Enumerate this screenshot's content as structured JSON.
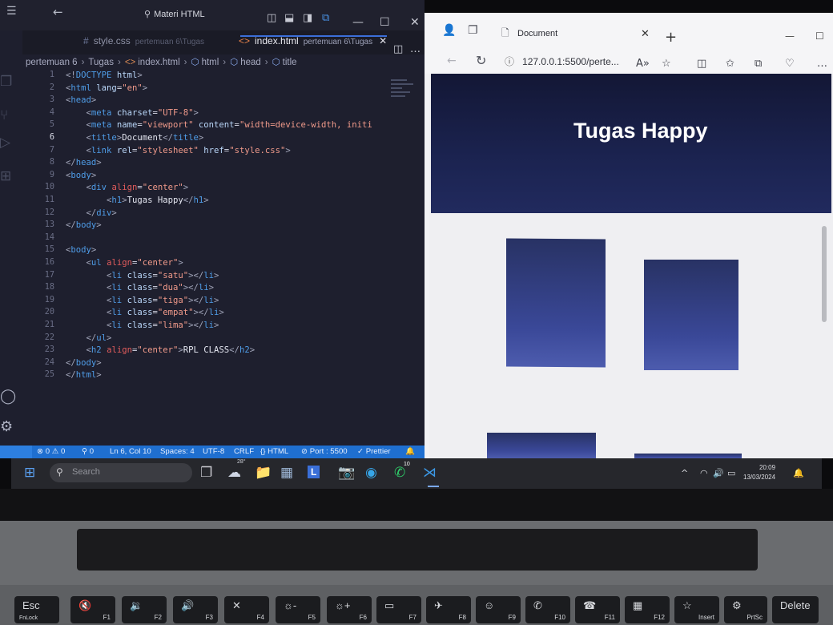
{
  "vscode": {
    "search_text": "Materi HTML",
    "tabs": [
      {
        "label": "style.css",
        "path": "pertemuan 6\\Tugas"
      },
      {
        "label": "index.html",
        "path": "pertemuan 6\\Tugas"
      }
    ],
    "breadcrumb": [
      "pertemuan 6",
      "Tugas",
      "index.html",
      "html",
      "head",
      "title"
    ],
    "lines": [
      {
        "n": "1",
        "html": "<span class='t-ang'>&lt;!</span><span class='t-tag'>DOCTYPE</span> <span class='t-attr'>html</span><span class='t-ang'>&gt;</span>"
      },
      {
        "n": "2",
        "html": "<span class='t-ang'>&lt;</span><span class='t-tag'>html</span> <span class='t-attr'>lang</span>=<span class='t-str'>\"en\"</span><span class='t-ang'>&gt;</span>"
      },
      {
        "n": "3",
        "html": "<span class='t-ang'>&lt;</span><span class='t-tag'>head</span><span class='t-ang'>&gt;</span>"
      },
      {
        "n": "4",
        "html": "    <span class='t-ang'>&lt;</span><span class='t-tag'>meta</span> <span class='t-attr'>charset</span>=<span class='t-str'>\"UTF-8\"</span><span class='t-ang'>&gt;</span>"
      },
      {
        "n": "5",
        "html": "    <span class='t-ang'>&lt;</span><span class='t-tag'>meta</span> <span class='t-attr'>name</span>=<span class='t-str'>\"viewport\"</span> <span class='t-attr'>content</span>=<span class='t-str'>\"width=device-width, initi</span>"
      },
      {
        "n": "6",
        "html": "    <span class='t-ang'>&lt;</span><span class='t-tag'>title</span><span class='t-ang'>&gt;</span><span class='t-txt'>Document</span><span class='t-ang'>&lt;/</span><span class='t-tag'>title</span><span class='t-ang'>&gt;</span>"
      },
      {
        "n": "7",
        "html": "    <span class='t-ang'>&lt;</span><span class='t-tag'>link</span> <span class='t-attr'>rel</span>=<span class='t-str'>\"stylesheet\"</span> <span class='t-attr'>href</span>=<span class='t-str'>\"style.css\"</span><span class='t-ang'>&gt;</span>"
      },
      {
        "n": "8",
        "html": "<span class='t-ang'>&lt;/</span><span class='t-tag'>head</span><span class='t-ang'>&gt;</span>"
      },
      {
        "n": "9",
        "html": "<span class='t-ang'>&lt;</span><span class='t-tag'>body</span><span class='t-ang'>&gt;</span>"
      },
      {
        "n": "10",
        "html": "    <span class='t-ang'>&lt;</span><span class='t-tag'>div</span> <span class='t-al'>align</span>=<span class='t-str'>\"center\"</span><span class='t-ang'>&gt;</span>"
      },
      {
        "n": "11",
        "html": "        <span class='t-ang'>&lt;</span><span class='t-tag'>h1</span><span class='t-ang'>&gt;</span><span class='t-txt'>Tugas Happy</span><span class='t-ang'>&lt;/</span><span class='t-tag'>h1</span><span class='t-ang'>&gt;</span>"
      },
      {
        "n": "12",
        "html": "    <span class='t-ang'>&lt;/</span><span class='t-tag'>div</span><span class='t-ang'>&gt;</span>"
      },
      {
        "n": "13",
        "html": "<span class='t-ang'>&lt;/</span><span class='t-tag'>body</span><span class='t-ang'>&gt;</span>"
      },
      {
        "n": "14",
        "html": ""
      },
      {
        "n": "15",
        "html": "<span class='t-ang'>&lt;</span><span class='t-tag'>body</span><span class='t-ang'>&gt;</span>"
      },
      {
        "n": "16",
        "html": "    <span class='t-ang'>&lt;</span><span class='t-tag'>ul</span> <span class='t-al'>align</span>=<span class='t-str'>\"center\"</span><span class='t-ang'>&gt;</span>"
      },
      {
        "n": "17",
        "html": "        <span class='t-ang'>&lt;</span><span class='t-tag'>li</span> <span class='t-attr'>class</span>=<span class='t-str'>\"satu\"</span><span class='t-ang'>&gt;&lt;/</span><span class='t-tag'>li</span><span class='t-ang'>&gt;</span>"
      },
      {
        "n": "18",
        "html": "        <span class='t-ang'>&lt;</span><span class='t-tag'>li</span> <span class='t-attr'>class</span>=<span class='t-str'>\"dua\"</span><span class='t-ang'>&gt;&lt;/</span><span class='t-tag'>li</span><span class='t-ang'>&gt;</span>"
      },
      {
        "n": "19",
        "html": "        <span class='t-ang'>&lt;</span><span class='t-tag'>li</span> <span class='t-attr'>class</span>=<span class='t-str'>\"tiga\"</span><span class='t-ang'>&gt;&lt;/</span><span class='t-tag'>li</span><span class='t-ang'>&gt;</span>"
      },
      {
        "n": "20",
        "html": "        <span class='t-ang'>&lt;</span><span class='t-tag'>li</span> <span class='t-attr'>class</span>=<span class='t-str'>\"empat\"</span><span class='t-ang'>&gt;&lt;/</span><span class='t-tag'>li</span><span class='t-ang'>&gt;</span>"
      },
      {
        "n": "21",
        "html": "        <span class='t-ang'>&lt;</span><span class='t-tag'>li</span> <span class='t-attr'>class</span>=<span class='t-str'>\"lima\"</span><span class='t-ang'>&gt;&lt;/</span><span class='t-tag'>li</span><span class='t-ang'>&gt;</span>"
      },
      {
        "n": "22",
        "html": "    <span class='t-ang'>&lt;/</span><span class='t-tag'>ul</span><span class='t-ang'>&gt;</span>"
      },
      {
        "n": "23",
        "html": "    <span class='t-ang'>&lt;</span><span class='t-tag'>h2</span> <span class='t-al'>align</span>=<span class='t-str'>\"center\"</span><span class='t-ang'>&gt;</span><span class='t-txt'>RPL CLASS</span><span class='t-ang'>&lt;/</span><span class='t-tag'>h2</span><span class='t-ang'>&gt;</span>"
      },
      {
        "n": "24",
        "html": "<span class='t-ang'>&lt;/</span><span class='t-tag'>body</span><span class='t-ang'>&gt;</span>"
      },
      {
        "n": "25",
        "html": "<span class='t-ang'>&lt;/</span><span class='t-tag'>html</span><span class='t-ang'>&gt;</span>"
      }
    ],
    "current_line": "6",
    "status": {
      "problems": "⊗ 0 ⚠ 0",
      "ports": "⚲ 0",
      "position": "Ln 6, Col 10",
      "spaces": "Spaces: 4",
      "encoding": "UTF-8",
      "eol": "CRLF",
      "language": "{} HTML",
      "port": "⊘ Port : 5500",
      "prettier": "✓ Prettier"
    },
    "colors": {
      "status_bar": "#1f6fd0",
      "editor_bg": "#1e1f2e",
      "tag": "#4f9de8",
      "string": "#f09a8a"
    }
  },
  "browser": {
    "tab_title": "Document",
    "address": "127.0.0.1:5500/perte...",
    "page_heading": "Tugas Happy",
    "colors": {
      "hero": "#1b2350",
      "box": "#3a4898"
    }
  },
  "taskbar": {
    "search_placeholder": "Search",
    "weather": "28°",
    "whatsapp_badge": "10",
    "time": "20:09",
    "date": "13/03/2024"
  },
  "keyboard": {
    "keys": [
      {
        "main": "Esc",
        "sub": "FnLock",
        "fn": ""
      },
      {
        "main": "🔇",
        "sub": "",
        "fn": "F1"
      },
      {
        "main": "🔉",
        "sub": "",
        "fn": "F2"
      },
      {
        "main": "🔊",
        "sub": "",
        "fn": "F3"
      },
      {
        "main": "✕",
        "sub": "",
        "fn": "F4"
      },
      {
        "main": "☼-",
        "sub": "",
        "fn": "F5"
      },
      {
        "main": "☼+",
        "sub": "",
        "fn": "F6"
      },
      {
        "main": "▭",
        "sub": "",
        "fn": "F7"
      },
      {
        "main": "✈",
        "sub": "",
        "fn": "F8"
      },
      {
        "main": "☺",
        "sub": "",
        "fn": "F9"
      },
      {
        "main": "✆",
        "sub": "",
        "fn": "F10"
      },
      {
        "main": "☎",
        "sub": "",
        "fn": "F11"
      },
      {
        "main": "▦",
        "sub": "",
        "fn": "F12"
      },
      {
        "main": "☆",
        "sub": "",
        "fn": "Insert"
      },
      {
        "main": "⚙",
        "sub": "",
        "fn": "PrtSc"
      },
      {
        "main": "Delete",
        "sub": "",
        "fn": ""
      }
    ]
  }
}
